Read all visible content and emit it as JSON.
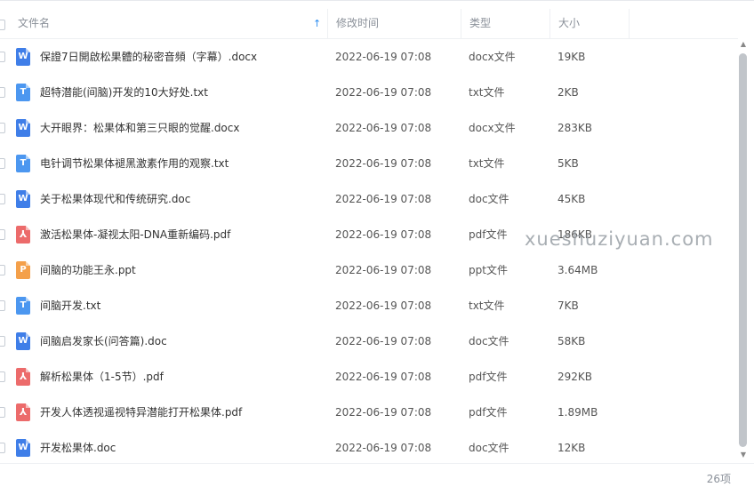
{
  "header": {
    "col_name": "文件名",
    "col_time": "修改时间",
    "col_type": "类型",
    "col_size": "大小"
  },
  "icons": {
    "W": {
      "letter": "W",
      "color": "#3f7ee8"
    },
    "T": {
      "letter": "T",
      "color": "#4c97f0"
    },
    "P": {
      "letter": "P",
      "color": "#f4a04a"
    },
    "PDF": {
      "letter": "⅄",
      "color": "#ec6b6b"
    }
  },
  "files": [
    {
      "name": "保證7日開啟松果體的秘密音頻（字幕）.docx",
      "time": "2022-06-19 07:08",
      "type": "docx文件",
      "size": "19KB",
      "icon": "W"
    },
    {
      "name": "超特潜能(间脑)开发的10大好处.txt",
      "time": "2022-06-19 07:08",
      "type": "txt文件",
      "size": "2KB",
      "icon": "T"
    },
    {
      "name": "大开眼界：松果体和第三只眼的觉醒.docx",
      "time": "2022-06-19 07:08",
      "type": "docx文件",
      "size": "283KB",
      "icon": "W"
    },
    {
      "name": "电针调节松果体褪黑激素作用的观察.txt",
      "time": "2022-06-19 07:08",
      "type": "txt文件",
      "size": "5KB",
      "icon": "T"
    },
    {
      "name": "关于松果体现代和传统研究.doc",
      "time": "2022-06-19 07:08",
      "type": "doc文件",
      "size": "45KB",
      "icon": "W"
    },
    {
      "name": "激活松果体-凝视太阳-DNA重新编码.pdf",
      "time": "2022-06-19 07:08",
      "type": "pdf文件",
      "size": "186KB",
      "icon": "PDF"
    },
    {
      "name": "间脑的功能王永.ppt",
      "time": "2022-06-19 07:08",
      "type": "ppt文件",
      "size": "3.64MB",
      "icon": "P"
    },
    {
      "name": "间脑开发.txt",
      "time": "2022-06-19 07:08",
      "type": "txt文件",
      "size": "7KB",
      "icon": "T"
    },
    {
      "name": "间脑启发家长(问答篇).doc",
      "time": "2022-06-19 07:08",
      "type": "doc文件",
      "size": "58KB",
      "icon": "W"
    },
    {
      "name": "解析松果体（1-5节）.pdf",
      "time": "2022-06-19 07:08",
      "type": "pdf文件",
      "size": "292KB",
      "icon": "PDF"
    },
    {
      "name": "开发人体透视遥视特异潜能打开松果体.pdf",
      "time": "2022-06-19 07:08",
      "type": "pdf文件",
      "size": "1.89MB",
      "icon": "PDF"
    },
    {
      "name": "开发松果体.doc",
      "time": "2022-06-19 07:08",
      "type": "doc文件",
      "size": "12KB",
      "icon": "W"
    }
  ],
  "footer": {
    "count": "26项"
  },
  "watermark": "xueshuziyuan.com"
}
